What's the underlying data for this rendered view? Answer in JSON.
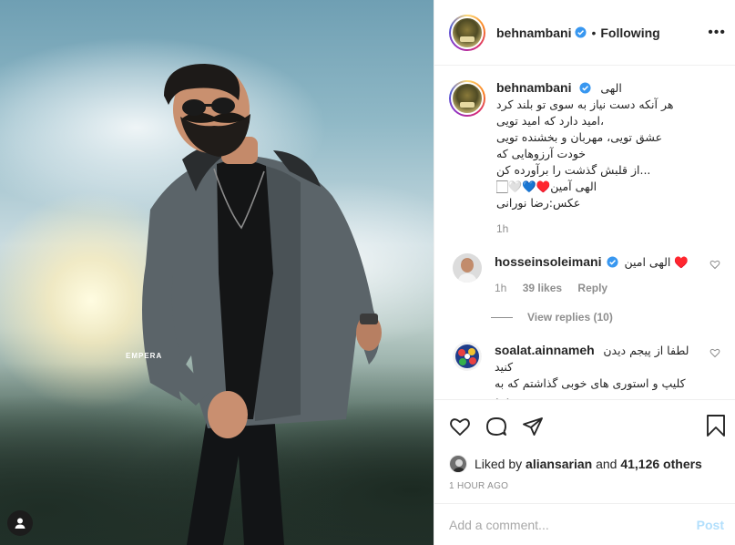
{
  "post": {
    "username": "behnambani",
    "follow_status": "Following",
    "more_label": "•••",
    "photo_watermark": "EMPERA"
  },
  "caption": {
    "username": "behnambani",
    "lines": [
      "الهی",
      "هر آنکه دست نیاز به سوی تو بلند کرد",
      "امید دارد که امید تویی،",
      "عشق تویی، مهربان و بخشنده تویی",
      "خودت آرزوهایی که",
      "از قلبش گذشت را برآورده کن...",
      "🏻🤍💙♥️الهی آمین",
      "عکس:رضا نورانی"
    ],
    "time": "1h"
  },
  "comments": [
    {
      "username": "hosseinsoleimani",
      "verified": true,
      "text": "الهی امین ♥️",
      "time": "1h",
      "likes": "39 likes",
      "reply_label": "Reply",
      "view_replies": "View replies (10)"
    },
    {
      "username": "soalat.ainnameh",
      "verified": false,
      "text_lines": [
        "لطفا از پیجم دیدن کنید",
        "کلیپ و استوری های خوبی گذاشتم که به درد"
      ]
    }
  ],
  "likes": {
    "prefix": "Liked by",
    "user": "aliansarian",
    "joiner": "and",
    "others": "41,126 others"
  },
  "timestamp": "1 HOUR AGO",
  "comment_box": {
    "placeholder": "Add a comment...",
    "post_label": "Post"
  },
  "colors": {
    "verified_blue": "#3897f0",
    "meta_gray": "#8e8e8e",
    "post_disabled": "#b2dffc"
  }
}
